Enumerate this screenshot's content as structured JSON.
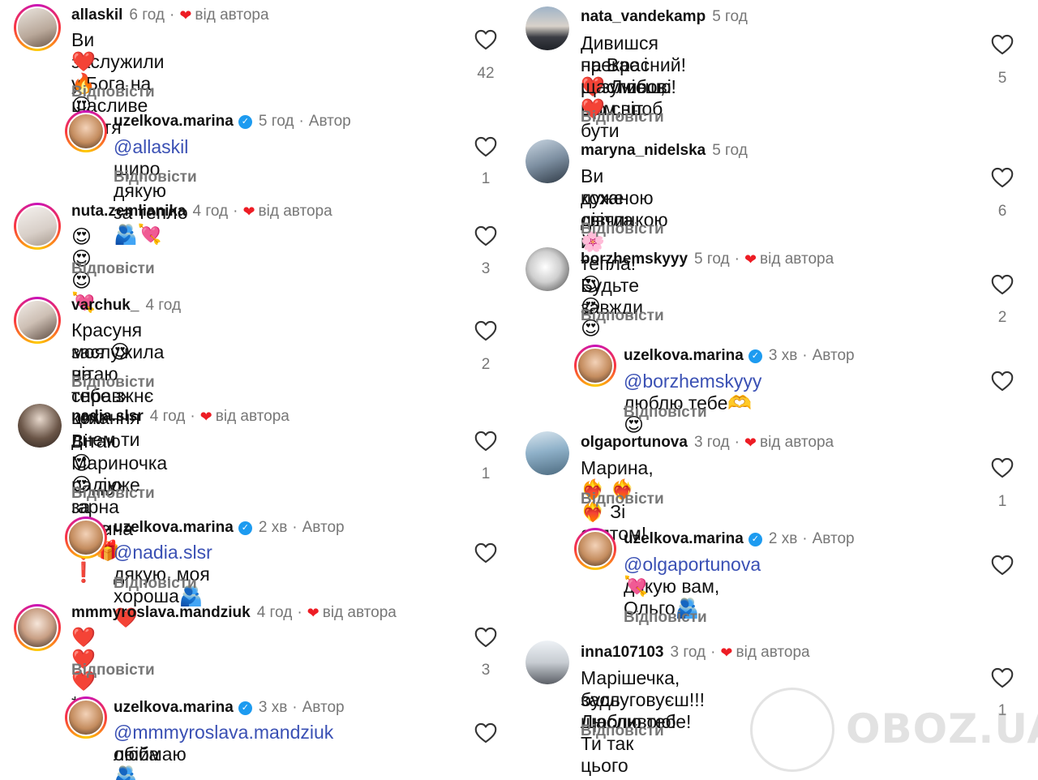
{
  "left_column": {
    "c1": {
      "user": "allaskil",
      "time": "6 год",
      "liked_label": "від автора",
      "text": "Ви заслужили у Бога на щасливе життя",
      "emoji": "❤️ 🔥 😍",
      "reply": "Відповісти",
      "likes": "42"
    },
    "r1": {
      "user": "uzelkova.marina",
      "time": "5 год",
      "author_label": "Автор",
      "mention": "@allaskil",
      "text": " щиро дякую за тепло",
      "emoji": "🫂💘",
      "reply": "Відповісти",
      "likes": "1"
    },
    "c2": {
      "user": "nuta.zemlianika",
      "time": "4 год",
      "liked_label": "від автора",
      "emoji": "😍😍😍💘",
      "reply": "Відповісти",
      "likes": "3"
    },
    "c3": {
      "user": "varchuk_",
      "time": "4 год",
      "text1": "Красуня моя ",
      "emoji": "😍",
      "text2": "вітаю тебе з цим днем ти",
      "text3": "заслужила на справжнє кохання",
      "reply": "Відповісти",
      "likes": "2"
    },
    "c4": {
      "user": "nadia.slsr",
      "time": "4 год",
      "liked_label": "від автора",
      "text1": "Вітаю Мариночка ",
      "emoji1": "😍",
      "text2": " дуже гарна новина",
      "emoji2": "😍",
      "text3": " радію за тебе ",
      "emoji3": "❤️🎁❗",
      "reply": "Відповісти",
      "likes": "1"
    },
    "r4": {
      "user": "uzelkova.marina",
      "time": "2 хв",
      "author_label": "Автор",
      "mention": "@nadia.slsr",
      "text": " дякую, моя хороша",
      "emoji": "🫂 ❤️",
      "reply": "Відповісти"
    },
    "c5": {
      "user": "mmmyroslava.mandziuk",
      "time": "4 год",
      "liked_label": "від автора",
      "emoji": "❤️❤️❤️",
      "text": "*",
      "reply": "Відповісти",
      "likes": "3"
    },
    "r5": {
      "user": "uzelkova.marina",
      "time": "3 хв",
      "author_label": "Автор",
      "mention": "@mmmyroslava.mandziuk",
      "text": " обіймаю",
      "text2": "люба",
      "emoji": "🫂"
    }
  },
  "right_column": {
    "c1": {
      "user": "nata_vandekamp",
      "time": "5 год",
      "text1": "Дивишся на Вас і розумієш, що світ",
      "text2": "прекрасний!",
      "emoji1": "❤️",
      "text3": " Любові Вам, щоб бути",
      "text4": "щасливою!",
      "emoji2": "❤️",
      "reply": "Відповісти",
      "likes": "5"
    },
    "c2": {
      "user": "maryna_nidelska",
      "time": "5 год",
      "text1": "Ви дуже світла й тепла! Будьте завжди",
      "text2": "коханою дівчинкою ",
      "emoji": "🌸",
      "reply": "Відповісти",
      "likes": "6"
    },
    "c3": {
      "user": "borzhemskyyy",
      "time": "5 год",
      "liked_label": "від автора",
      "emoji": "😍😍😍",
      "reply": "Відповісти",
      "likes": "2"
    },
    "r3": {
      "user": "uzelkova.marina",
      "time": "3 хв",
      "author_label": "Автор",
      "mention": "@borzhemskyyy",
      "text": " люблю тебе",
      "emoji": "🫶 😍",
      "reply": "Відповісти"
    },
    "c4": {
      "user": "olgaportunova",
      "time": "3 год",
      "liked_label": "від автора",
      "text1": "Марина, ",
      "emoji": "❤️‍🔥 ❤️‍🔥 ❤️‍🔥",
      "text2": " Зі святом!",
      "reply": "Відповісти",
      "likes": "1"
    },
    "r4": {
      "user": "uzelkova.marina",
      "time": "2 хв",
      "author_label": "Автор",
      "mention": "@olgaportunova",
      "text": " дякую вам, Ольго",
      "emoji": "🫂",
      "emoji2": "💘",
      "reply": "Відповісти"
    },
    "c5": {
      "user": "inna107103",
      "time": "3 год",
      "liked_label": "від автора",
      "text1": "Марішечка, будь щасливою! Ти так цього",
      "text2": "заслуговуєш!!!Люблю тебе!",
      "reply": "Відповісти",
      "likes": "1"
    }
  },
  "watermark": {
    "text": "OBOZ.UA"
  },
  "colors": {
    "mention": "#3a50b4",
    "heart": "#ed1c24",
    "verified": "#1d9bf0",
    "muted": "#777777"
  }
}
